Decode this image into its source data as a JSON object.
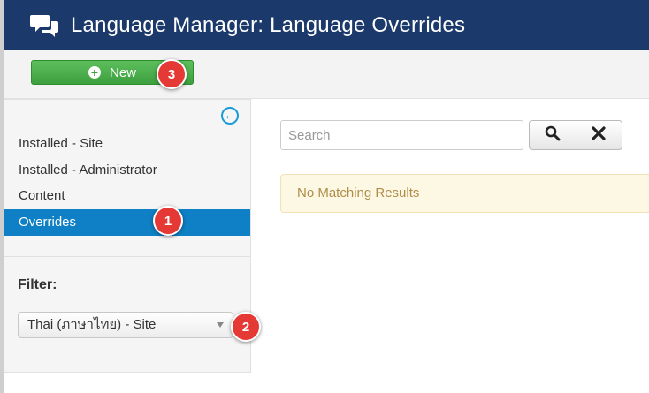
{
  "header": {
    "title": "Language Manager: Language Overrides",
    "icon": "comments-icon"
  },
  "toolbar": {
    "new_label": "New"
  },
  "sidebar": {
    "items": [
      {
        "label": "Installed - Site",
        "active": false
      },
      {
        "label": "Installed - Administrator",
        "active": false
      },
      {
        "label": "Content",
        "active": false
      },
      {
        "label": "Overrides",
        "active": true
      }
    ],
    "filter_label": "Filter:",
    "filter_value": "Thai (ภาษาไทย) - Site"
  },
  "search": {
    "placeholder": "Search",
    "value": ""
  },
  "results": {
    "message": "No Matching Results"
  },
  "annotations": [
    "1",
    "2",
    "3"
  ],
  "colors": {
    "header_bg": "#1b3a6b",
    "new_button": "#4cae4c",
    "active_nav": "#0f80c6",
    "alert_bg": "#fcf8e3",
    "alert_text": "#b08d4a",
    "badge": "#e53935"
  }
}
